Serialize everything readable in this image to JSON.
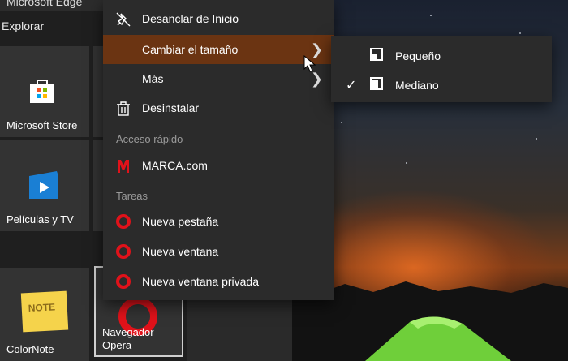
{
  "start_menu": {
    "top_app_label": "Microsoft Edge",
    "group_label": "Explorar",
    "tiles": [
      {
        "label": "Microsoft Store"
      },
      {
        "label": "Películas y TV"
      },
      {
        "label": "ColorNote"
      },
      {
        "label_line1": "Navegador",
        "label_line2": "Opera"
      }
    ],
    "colornote_badge": "NOTE"
  },
  "context_menu": {
    "items": [
      {
        "label": "Desanclar de Inicio",
        "icon": "unpin-icon"
      },
      {
        "label": "Cambiar el tamaño",
        "icon": "none",
        "has_submenu": true,
        "highlighted": true
      },
      {
        "label": "Más",
        "icon": "none",
        "has_submenu": true
      },
      {
        "label": "Desinstalar",
        "icon": "trash-icon"
      }
    ],
    "quick_access_label": "Acceso rápido",
    "quick_access_items": [
      {
        "label": "MARCA.com",
        "icon": "marca-logo-icon"
      }
    ],
    "tasks_label": "Tareas",
    "task_items": [
      {
        "label": "Nueva pestaña",
        "icon": "opera-icon"
      },
      {
        "label": "Nueva ventana",
        "icon": "opera-icon"
      },
      {
        "label": "Nueva ventana privada",
        "icon": "opera-icon"
      }
    ]
  },
  "size_submenu": {
    "items": [
      {
        "label": "Pequeño",
        "checked": false
      },
      {
        "label": "Mediano",
        "checked": true
      }
    ]
  },
  "colors": {
    "highlight": "#6b3412",
    "menu_bg": "#2b2b2b",
    "opera_red": "#e0121a"
  }
}
